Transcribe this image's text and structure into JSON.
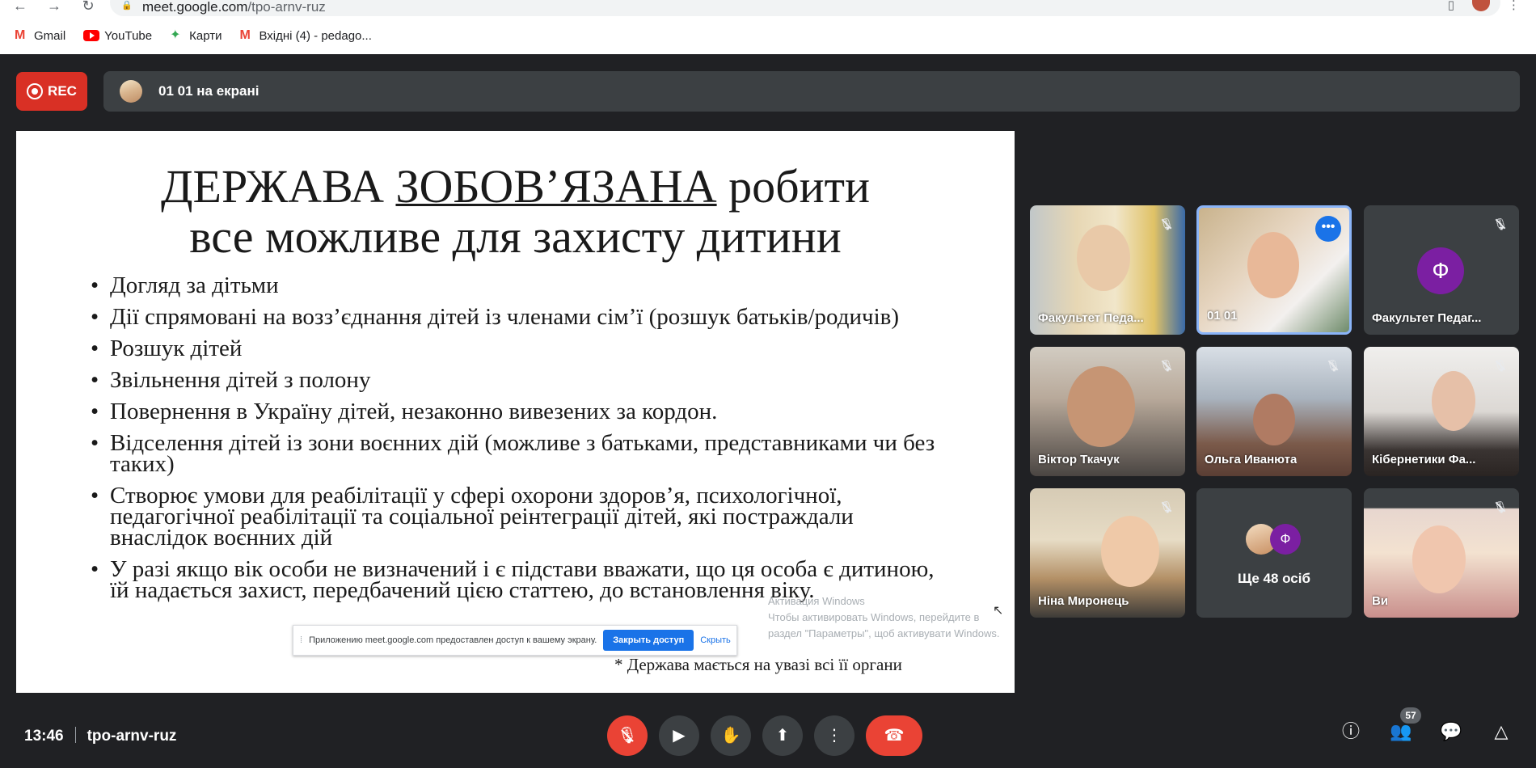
{
  "browser": {
    "url_host": "meet.google.com",
    "url_path": "/tpo-arnv-ruz",
    "bookmarks": [
      {
        "label": "Gmail",
        "icon": "gmail-icon"
      },
      {
        "label": "YouTube",
        "icon": "youtube-icon"
      },
      {
        "label": "Карти",
        "icon": "maps-icon"
      },
      {
        "label": "Вхідні (4) - pedago...",
        "icon": "gmail-icon"
      }
    ]
  },
  "meet": {
    "rec_label": "REC",
    "presenting_text": "01 01 на екрані",
    "meeting_time": "13:46",
    "meeting_code": "tpo-arnv-ruz",
    "participants_count": "57"
  },
  "slide": {
    "title_part1": "ДЕРЖАВА ",
    "title_underlined": "ЗОБОВ’ЯЗАНА",
    "title_part2": " робити",
    "title_line2": "все можливе для захисту дитини",
    "bullets": [
      "Догляд за дітьми",
      "Дії спрямовані на возз’єднання дітей із членами сім’ї (розшук батьків/родичів)",
      "Розшук дітей",
      "Звільнення дітей з полону",
      "Повернення в Україну дітей, незаконно вивезених за кордон.",
      "Відселення дітей із зони воєнних дій (можливе з батьками, представниками чи без таких)",
      "Створює умови для реабілітації у сфері охорони здоров’я, психологічної, педагогічної реабілітації та соціальної реінтеграції дітей, які постраждали внаслідок воєнних дій",
      "У разі якщо вік особи не визначений і є підстави вважати, що ця особа є дитиною, їй надається захист, передбачений цією статтею, до встановлення віку."
    ],
    "footnote": "* Держава мається на увазі всі її органи",
    "watermark_line1": "Активация Windows",
    "watermark_line2": "Чтобы активировать Windows, перейдите в раздел \"Параметры\", щоб активувати Windows."
  },
  "share_notice": {
    "message": "Приложению meet.google.com предоставлен доступ к вашему экрану.",
    "stop_label": "Закрыть доступ",
    "hide_label": "Скрыть"
  },
  "tiles": [
    {
      "name": "Факультет Педа..."
    },
    {
      "name": "01 01"
    },
    {
      "name": "Факультет Педаг...",
      "initial": "Ф"
    },
    {
      "name": "Віктор Ткачук"
    },
    {
      "name": "Ольга Иванюта"
    },
    {
      "name": "Кібернетики Фа..."
    },
    {
      "name": "Ніна Миронець"
    },
    {
      "more_label": "Ще 48 осіб",
      "initial": "Ф"
    },
    {
      "name": "Ви"
    }
  ],
  "colors": {
    "background": "#202124",
    "tile": "#3c4043",
    "rec_red": "#d93025",
    "end_call_red": "#ea4335",
    "avatar_purple": "#7b1fa2",
    "active_border": "#8ab4f8"
  }
}
